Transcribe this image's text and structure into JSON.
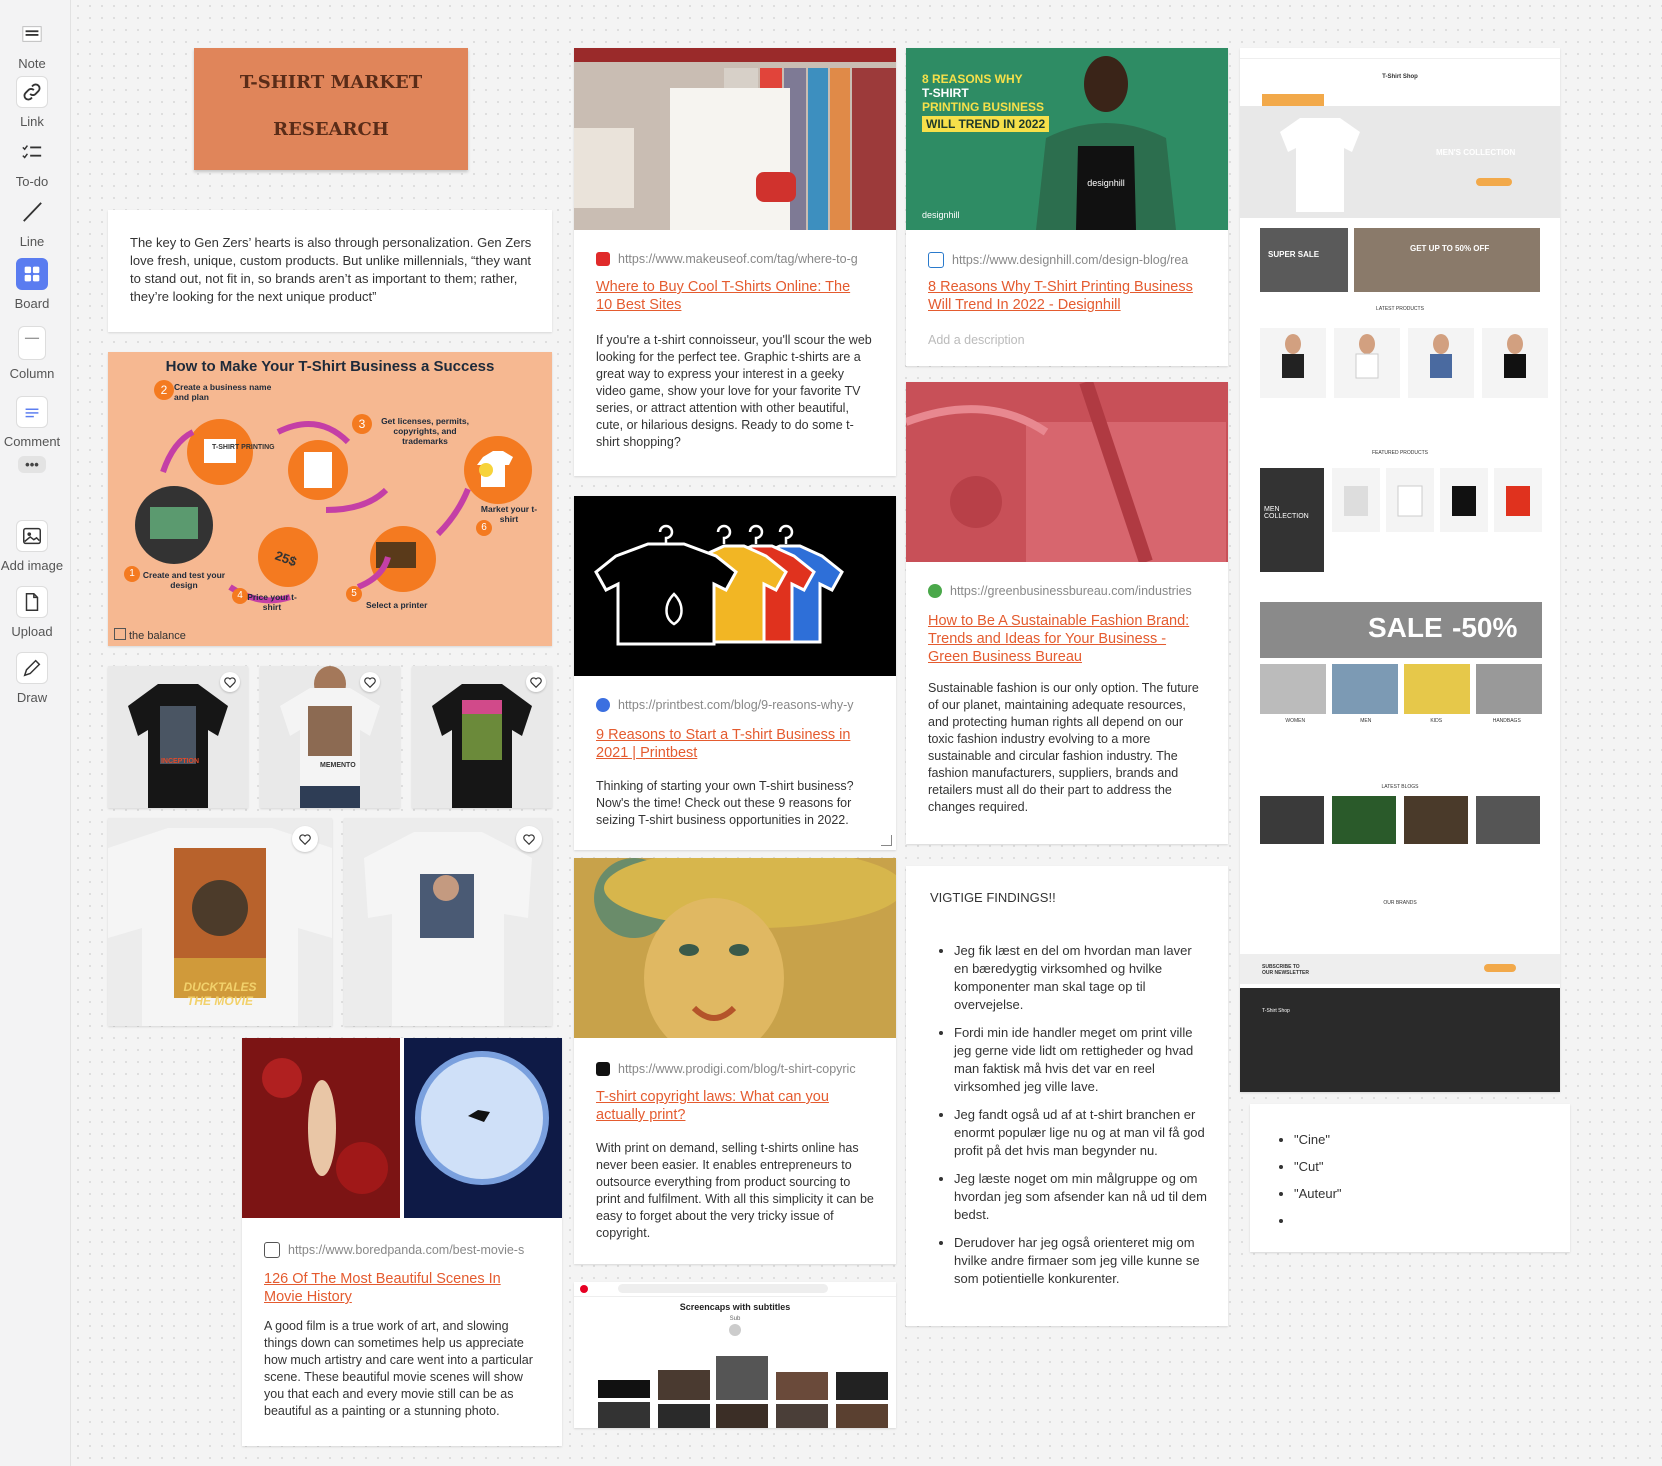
{
  "sidebar": {
    "tools": [
      {
        "label": "Note",
        "icon": "note-icon"
      },
      {
        "label": "Link",
        "icon": "link-icon"
      },
      {
        "label": "To-do",
        "icon": "todo-icon"
      },
      {
        "label": "Line",
        "icon": "line-icon"
      },
      {
        "label": "Board",
        "icon": "board-icon"
      },
      {
        "label": "Column",
        "icon": "column-icon"
      },
      {
        "label": "Comment",
        "icon": "comment-icon"
      },
      {
        "label": "Add image",
        "icon": "add-image-icon"
      },
      {
        "label": "Upload",
        "icon": "upload-icon"
      },
      {
        "label": "Draw",
        "icon": "draw-icon"
      }
    ],
    "more_label": "•••"
  },
  "colors": {
    "accent": "#e45b2f",
    "title_card": "#e0855a",
    "board_icon": "#5a7cf0"
  },
  "title_card": {
    "line1": "T-SHIRT MARKET",
    "line2": "RESEARCH"
  },
  "quote_note": {
    "text": "The key to Gen Zers’ hearts is also through personalization. Gen Zers love fresh, unique, custom products. But unlike millennials, “they want to stand out, not fit in, so brands aren’t as important to them; rather, they’re looking for the next unique product”"
  },
  "infographic": {
    "title": "How to Make Your T-Shirt Business a Success",
    "steps": [
      {
        "n": "1",
        "label": "Create and test your design"
      },
      {
        "n": "2",
        "label": "Create a business name and plan"
      },
      {
        "n": "3",
        "label": "Get licenses, permits, copyrights, and trademarks"
      },
      {
        "n": "4",
        "label": "Price your t-shirt"
      },
      {
        "n": "5",
        "label": "Select a printer"
      },
      {
        "n": "6",
        "label": "Market your t-shirt"
      }
    ],
    "price_tag": "25$",
    "tee_text": "T-SHIRT PRINTING",
    "brand": "the balance"
  },
  "tee_images": {
    "inception_text": "INCEPTION",
    "memento_text": "MEMENTO",
    "duck_text": "DUCKTALES THE MOVIE"
  },
  "links": [
    {
      "url": "https://www.makeuseof.com/tag/where-to-g",
      "title": "Where to Buy Cool T-Shirts Online: The 10 Best Sites",
      "desc": "If you're a t-shirt connoisseur, you'll scour the web looking for the perfect tee. Graphic t-shirts are a great way to express your interest in a geeky video game, show your love for your favorite TV series, or attract attention with other beautiful, cute, or hilarious designs. Ready to do some t-shirt shopping?"
    },
    {
      "url": "https://printbest.com/blog/9-reasons-why-y",
      "title": "9 Reasons to Start a T-shirt Business in 2021 | Printbest",
      "desc": "Thinking of starting your own T-shirt business? Now's the time! Check out these 9 reasons for seizing T-shirt business opportunities in 2022."
    },
    {
      "url": "https://www.prodigi.com/blog/t-shirt-copyric",
      "title": "T-shirt copyright laws: What can you actually print?",
      "desc": "With print on demand, selling t-shirts online has never been easier. It enables entrepreneurs to outsource everything from product sourcing to print and fulfilment. With all this simplicity it can be easy to forget about the very tricky issue of copyright."
    },
    {
      "url": "https://www.designhill.com/design-blog/rea",
      "title": "8 Reasons Why T-Shirt Printing Business Will Trend In 2022 - Designhill",
      "desc": "Add a description"
    },
    {
      "url": "https://greenbusinessbureau.com/industries",
      "title": "How to Be A Sustainable Fashion Brand: Trends and Ideas for Your Business - Green Business Bureau",
      "desc": "Sustainable fashion is our only option. The future of our planet, maintaining adequate resources, and protecting human rights all depend on our toxic fashion industry evolving to a more sustainable and circular fashion industry. The fashion manufacturers, suppliers, brands and retailers must all do their part to address the changes required."
    },
    {
      "url": "https://www.boredpanda.com/best-movie-s",
      "title": "126 Of The Most Beautiful Scenes In Movie History",
      "desc": "A good film is a true work of art, and slowing things down can sometimes help us appreciate how much artistry and care went into a particular scene. These beautiful movie scenes will show you that each and every movie still can be as beautiful as a painting or a stunning photo."
    }
  ],
  "designhill_banner": {
    "line1": "8 REASONS WHY",
    "line2": "T-SHIRT",
    "line3": "PRINTING BUSINESS",
    "line4": "WILL TREND IN 2022",
    "shirt_logo": "designhill",
    "corner_logo": "designhill"
  },
  "pinterest": {
    "title": "Screencaps with subtitles",
    "sub": "Sub"
  },
  "findings": {
    "heading": "VIGTIGE FINDINGS!!",
    "items": [
      "Jeg fik læst en del om hvordan man laver en bæredygtig virksomhed og hvilke komponenter man skal tage op til overvejelse.",
      "Fordi min ide handler meget om print ville jeg gerne vide lidt om rettigheder og hvad man faktisk må hvis det var en reel virksomhed jeg ville lave.",
      "Jeg fandt også ud af at t-shirt branchen er enormt populær lige nu og at man vil få god profit på det hvis man begynder nu.",
      "Jeg læste noget om min målgruppe og om hvordan jeg som afsender kan nå ud til dem bedst.",
      "Derudover har jeg også orienteret mig om hvilke andre firmaer som jeg ville kunne se som potientielle konkurenter."
    ]
  },
  "shop": {
    "name": "T-Shirt Shop",
    "hero": "MEN'S COLLECTION",
    "promo1": "SUPER SALE",
    "promo2": "GET UP TO 50% OFF",
    "latest": "LATEST PRODUCTS",
    "featured": "FEATURED PRODUCTS",
    "men": "MEN COLLECTION",
    "sale": "SALE",
    "pct": "-50%",
    "cats": [
      "WOMEN",
      "MEN",
      "KIDS",
      "HANDBAGS"
    ],
    "blogs": "LATEST BLOGS",
    "brands": "OUR BRANDS",
    "subscribe": "SUBSCRIBE TO OUR NEWSLETTER"
  },
  "words": {
    "items": [
      "\"Cine\"",
      "\"Cut\"",
      "\"Auteur\"",
      ""
    ]
  }
}
